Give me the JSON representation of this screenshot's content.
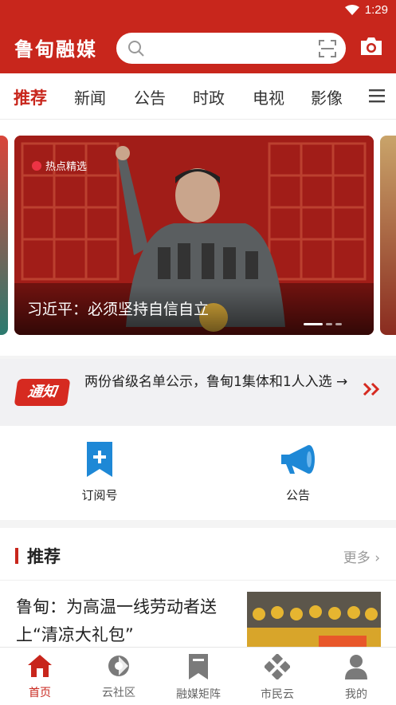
{
  "status_bar": {
    "time": "1:29"
  },
  "header": {
    "logo_text": "鲁甸融媒",
    "search_placeholder": ""
  },
  "tabs": [
    {
      "label": "推荐",
      "active": true
    },
    {
      "label": "新闻"
    },
    {
      "label": "公告"
    },
    {
      "label": "时政"
    },
    {
      "label": "电视"
    },
    {
      "label": "影像"
    }
  ],
  "carousel": {
    "tag": "热点精选",
    "caption": "习近平：必须坚持自信自立"
  },
  "notice": {
    "badge": "通知",
    "text": "两份省级名单公示，鲁甸1集体和1人入选 →"
  },
  "quick_entries": [
    {
      "label": "订阅号",
      "icon": "bookmark-plus-icon"
    },
    {
      "label": "公告",
      "icon": "megaphone-icon"
    }
  ],
  "recommend": {
    "title": "推荐",
    "more": "更多",
    "article": {
      "headline": "鲁甸：为高温一线劳动者送上“清凉大礼包”"
    }
  },
  "tab_bar": [
    {
      "label": "首页",
      "icon": "home-icon",
      "active": true
    },
    {
      "label": "云社区",
      "icon": "cloud-community-icon"
    },
    {
      "label": "融媒矩阵",
      "icon": "bookmark-icon"
    },
    {
      "label": "市民云",
      "icon": "diamond-grid-icon"
    },
    {
      "label": "我的",
      "icon": "person-icon"
    }
  ],
  "colors": {
    "brand": "#c8261c",
    "icon_blue": "#1e88d6"
  }
}
